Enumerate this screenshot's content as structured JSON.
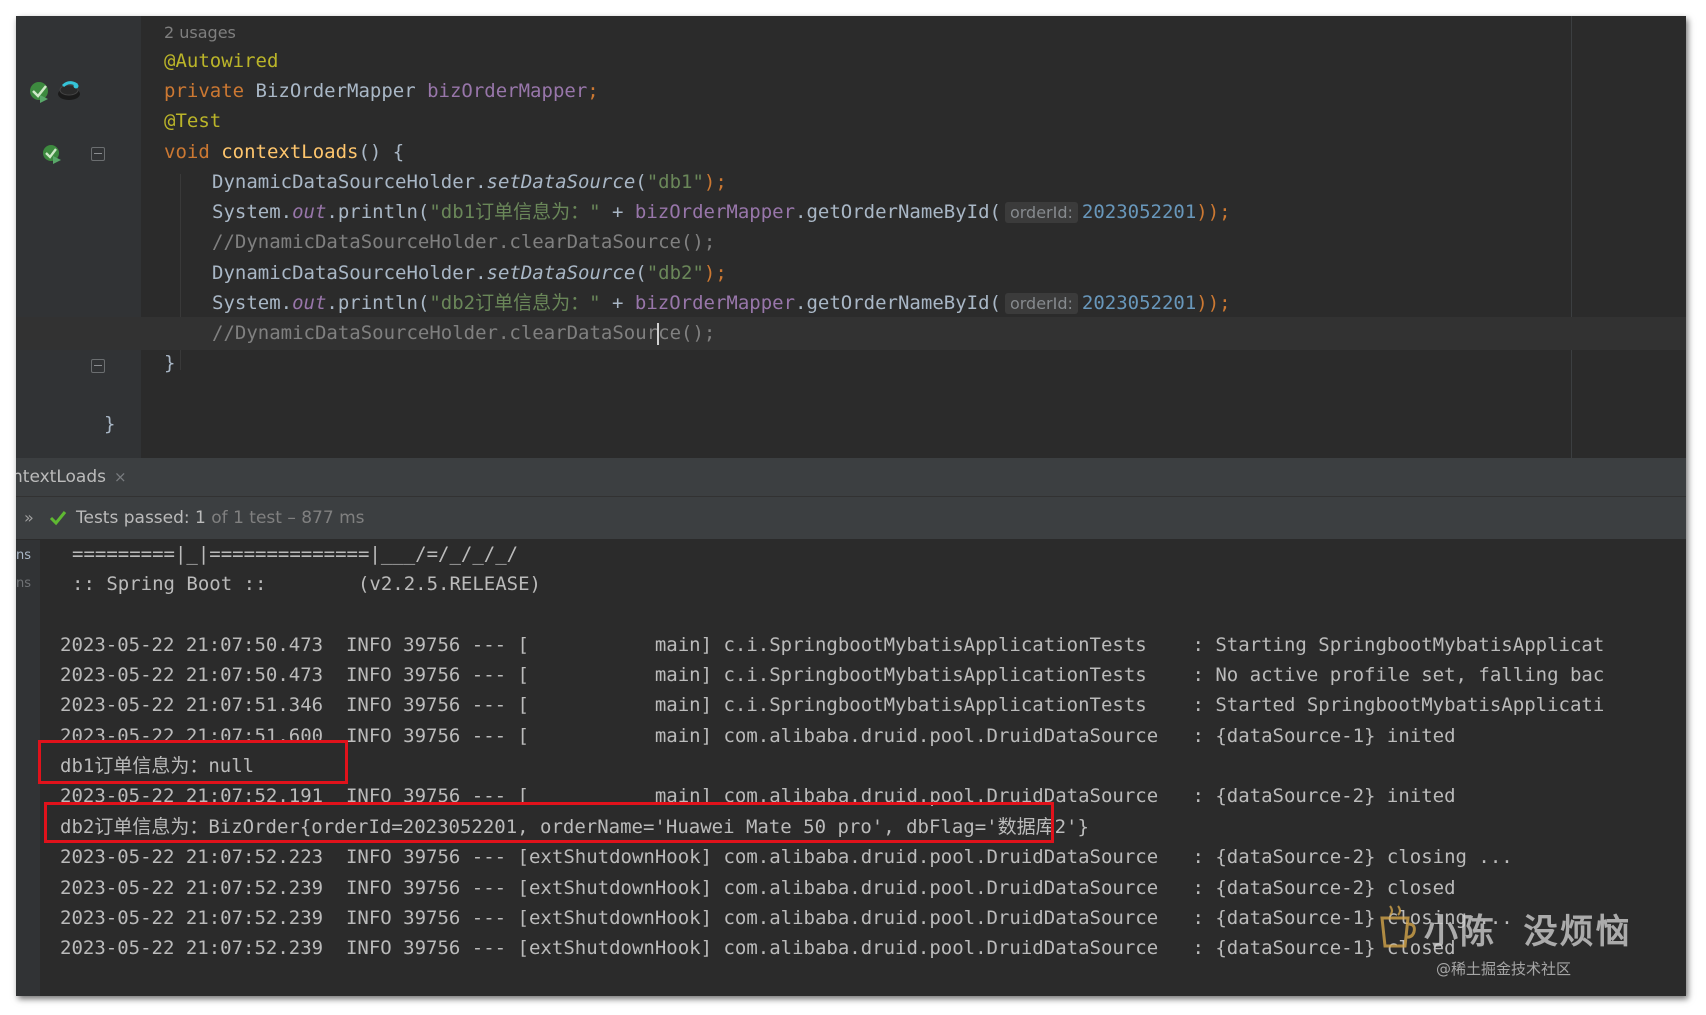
{
  "editor": {
    "lines": [
      {
        "id": "usages",
        "text": "2 usages"
      },
      {
        "id": "autowired",
        "annotation": "@Autowired"
      },
      {
        "id": "field-decl",
        "keyword": "private",
        "type": " BizOrderMapper ",
        "name": "bizOrderMapper",
        "semi": ";"
      },
      {
        "id": "test-annotation",
        "annotation": "@Test"
      },
      {
        "id": "method-decl",
        "keyword": "void",
        "name": " contextLoads",
        "rest": "() {"
      },
      {
        "id": "set-db1",
        "cls": "DynamicDataSourceHolder.",
        "method": "setDataSource",
        "open": "(",
        "arg": "\"db1\"",
        "close": ");"
      },
      {
        "id": "print-db1",
        "p1": "System.",
        "out": "out",
        "p2": ".println(",
        "str": "\"db1订单信息为：\"",
        "plus": " + ",
        "field": "bizOrderMapper",
        "call": ".getOrderNameById(",
        "hint": "orderId:",
        "num": "2023052201",
        "end": "));"
      },
      {
        "id": "clear-comment-1",
        "comment": "//DynamicDataSourceHolder.clearDataSource();"
      },
      {
        "id": "set-db2",
        "cls": "DynamicDataSourceHolder.",
        "method": "setDataSource",
        "open": "(",
        "arg": "\"db2\"",
        "close": ");"
      },
      {
        "id": "print-db2",
        "p1": "System.",
        "out": "out",
        "p2": ".println(",
        "str": "\"db2订单信息为：\"",
        "plus": " + ",
        "field": "bizOrderMapper",
        "call": ".getOrderNameById(",
        "hint": "orderId:",
        "num": "2023052201",
        "end": "));"
      },
      {
        "id": "clear-comment-2",
        "comment_a": "//DynamicDataSourceHolder.clearDataSour",
        "comment_b": "ce();"
      },
      {
        "id": "close-brace",
        "text": "}"
      },
      {
        "id": "class-brace",
        "text": "}"
      }
    ]
  },
  "run_panel": {
    "tab_label": "ntextLoads",
    "tab_close": "×",
    "chevron": "»",
    "status_prefix": "Tests passed: ",
    "status_count": "1",
    "status_suffix": " of 1 test – 877 ms",
    "time_labels": [
      "ns",
      "ns"
    ]
  },
  "console": {
    "banner": [
      "=========|_|==============|___/=/_/_/_/",
      ":: Spring Boot ::        (v2.2.5.RELEASE)"
    ],
    "lines": [
      "2023-05-22 21:07:50.473  INFO 39756 --- [           main] c.i.SpringbootMybatisApplicationTests    : Starting SpringbootMybatisApplicat",
      "2023-05-22 21:07:50.473  INFO 39756 --- [           main] c.i.SpringbootMybatisApplicationTests    : No active profile set, falling bac",
      "2023-05-22 21:07:51.346  INFO 39756 --- [           main] c.i.SpringbootMybatisApplicationTests    : Started SpringbootMybatisApplicati",
      "2023-05-22 21:07:51.600  INFO 39756 --- [           main] com.alibaba.druid.pool.DruidDataSource   : {dataSource-1} inited",
      "db1订单信息为：null",
      "2023-05-22 21:07:52.191  INFO 39756 --- [           main] com.alibaba.druid.pool.DruidDataSource   : {dataSource-2} inited",
      "db2订单信息为：BizOrder{orderId=2023052201, orderName='Huawei Mate 50 pro', dbFlag='数据库2'}",
      "2023-05-22 21:07:52.223  INFO 39756 --- [extShutdownHook] com.alibaba.druid.pool.DruidDataSource   : {dataSource-2} closing ...",
      "2023-05-22 21:07:52.239  INFO 39756 --- [extShutdownHook] com.alibaba.druid.pool.DruidDataSource   : {dataSource-2} closed",
      "2023-05-22 21:07:52.239  INFO 39756 --- [extShutdownHook] com.alibaba.druid.pool.DruidDataSource   : {dataSource-1} closing ...",
      "2023-05-22 21:07:52.239  INFO 39756 --- [extShutdownHook] com.alibaba.druid.pool.DruidDataSource   : {dataSource-1} closed"
    ]
  },
  "watermark": {
    "title": "小陈  没烦恼",
    "subtitle": "@稀土掘金技术社区"
  },
  "colors": {
    "editor_bg": "#2b2b2b",
    "gutter_bg": "#313335",
    "highlight_box": "#e0121b",
    "annotation": "#bbb529",
    "keyword": "#cc7832",
    "string": "#6a8759",
    "number": "#6897bb",
    "field": "#9876aa",
    "test_pass_green": "#5fb832"
  },
  "icons": [
    "run-test-icon",
    "bean-navigation-icon",
    "run-method-icon",
    "fold-icon",
    "lightbulb-icon",
    "check-icon",
    "close-icon",
    "chevron-right-icon"
  ]
}
